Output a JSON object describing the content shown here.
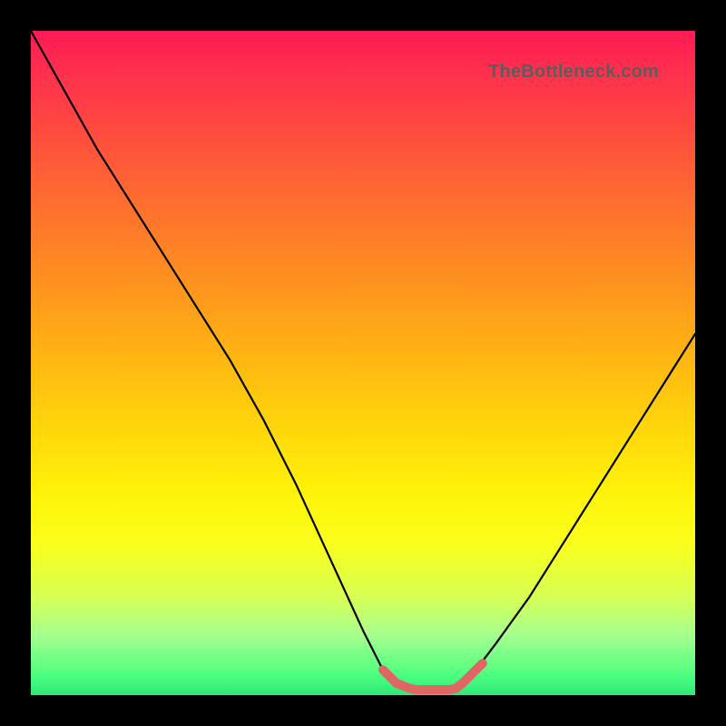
{
  "watermark": "TheBottleneck.com",
  "chart_data": {
    "type": "line",
    "title": "",
    "xlabel": "",
    "ylabel": "",
    "xlim": [
      0,
      100
    ],
    "ylim": [
      0,
      100
    ],
    "grid": false,
    "series": [
      {
        "name": "bottleneck-curve",
        "color": "#000000",
        "x": [
          0,
          5,
          10,
          15,
          20,
          25,
          30,
          35,
          40,
          45,
          50,
          53,
          55,
          57,
          59,
          61,
          63,
          65,
          67,
          70,
          75,
          80,
          85,
          90,
          95,
          100
        ],
        "values": [
          100,
          91,
          82,
          74,
          66,
          58,
          50,
          41,
          31,
          20,
          9,
          3,
          1,
          0,
          0,
          0,
          0,
          1,
          3,
          7,
          14,
          22,
          30,
          38,
          46,
          54
        ]
      },
      {
        "name": "optimal-zone",
        "color": "#e06666",
        "x": [
          53,
          55,
          57,
          58,
          59,
          60,
          61,
          62,
          63,
          64,
          65,
          66,
          67,
          68
        ],
        "values": [
          3.0,
          1.0,
          0.2,
          0.0,
          0.0,
          0.0,
          0.0,
          0.0,
          0.0,
          0.2,
          1.0,
          2.0,
          3.0,
          4.0
        ]
      }
    ],
    "background_gradient": {
      "top": "#ff1a55",
      "bottom": "#2ee876",
      "direction": "vertical"
    }
  }
}
